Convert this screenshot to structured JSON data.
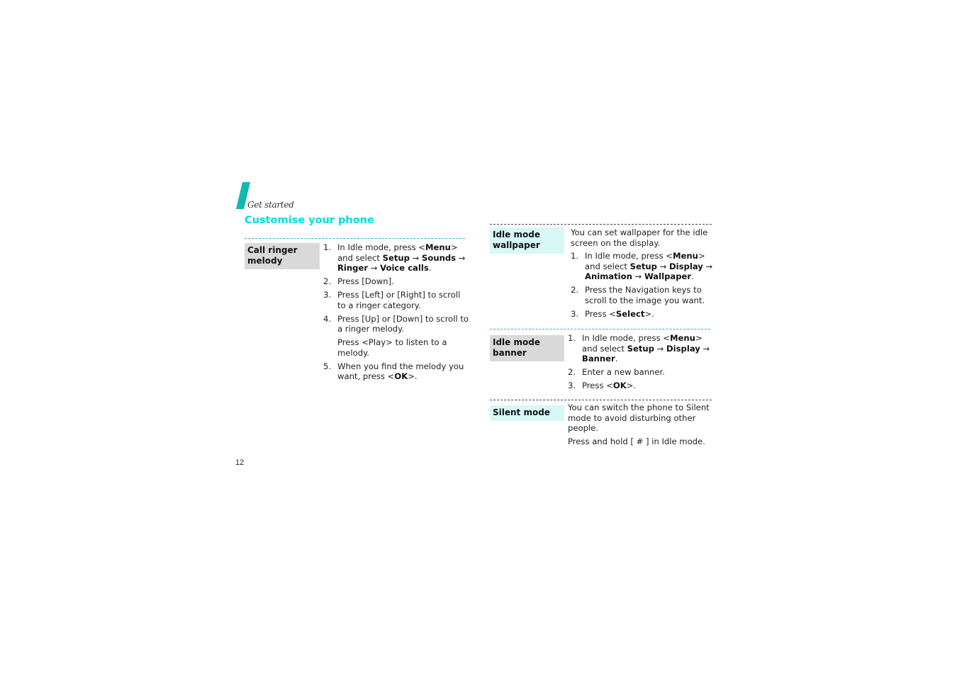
{
  "header": {
    "section": "Get started",
    "title": "Customise your phone",
    "accent_color": "#00dede"
  },
  "sections": [
    {
      "label": "Call ringer melody",
      "label_lines": [
        "Call ringer",
        "melody"
      ],
      "intro": "",
      "steps": [
        {
          "num": "1.",
          "parts": [
            "In Idle mode, press <",
            "Menu",
            ">",
            " and select ",
            "Setup",
            " → ",
            "Sounds",
            " → ",
            "Ringer",
            " → ",
            "Voice calls",
            "."
          ]
        },
        {
          "num": "2.",
          "text": "Press [Down]."
        },
        {
          "num": "3.",
          "text": "Press [Left] or [Right] to scroll to a ringer category."
        },
        {
          "num": "4.",
          "text": "Press [Up] or [Down] to scroll to a ringer melody.",
          "note": "Press <Play> to listen to a melody."
        },
        {
          "num": "5.",
          "parts": [
            "When you find the melody you want, press <",
            "OK",
            ">."
          ]
        }
      ]
    },
    {
      "label": "Idle mode wallpaper",
      "label_lines": [
        "Idle mode",
        "wallpaper"
      ],
      "intro": "You can set wallpaper for the idle screen on the display.",
      "steps": [
        {
          "num": "1.",
          "parts": [
            "In Idle mode, press <",
            "Menu",
            ">",
            " and select ",
            "Setup",
            " → ",
            "Display",
            " → ",
            "Animation",
            " → ",
            "Wallpaper",
            "."
          ]
        },
        {
          "num": "2.",
          "text": "Press the Navigation keys to scroll to the image you want."
        },
        {
          "num": "3.",
          "parts": [
            "Press <",
            "Select",
            ">."
          ]
        }
      ]
    },
    {
      "label": "Idle mode banner",
      "label_lines": [
        "Idle mode",
        "banner"
      ],
      "intro": "",
      "steps": [
        {
          "num": "1.",
          "parts": [
            "In Idle mode, press <",
            "Menu",
            ">",
            " and select ",
            "Setup",
            " → ",
            "Display",
            " → ",
            "Banner",
            "."
          ]
        },
        {
          "num": "2.",
          "text": "Enter a new banner."
        },
        {
          "num": "3.",
          "parts": [
            "Press <",
            "OK",
            ">."
          ]
        }
      ]
    },
    {
      "label": "Silent mode",
      "label_lines": [
        "Silent mode"
      ],
      "intro": "You can switch the phone to Silent mode to avoid disturbing other people.",
      "note": "Press and hold [ # ] in Idle mode."
    }
  ],
  "footer": {
    "page_number": "12"
  }
}
